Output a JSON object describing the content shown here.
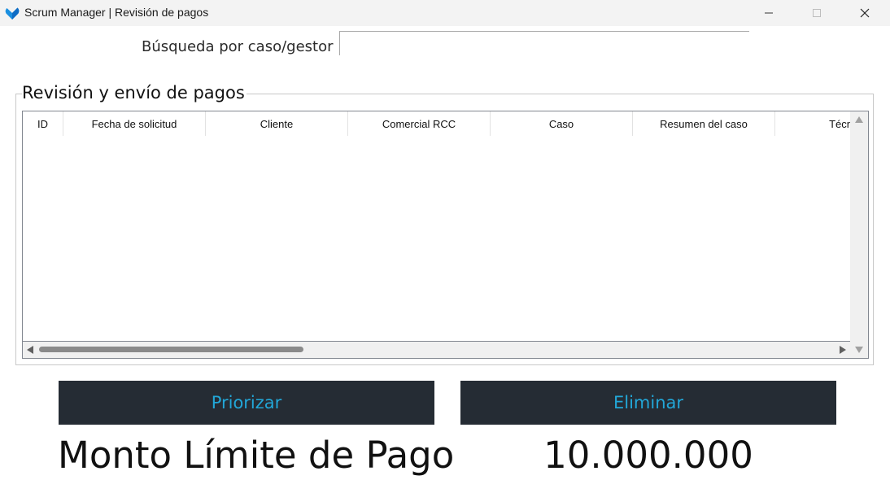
{
  "window": {
    "title": "Scrum Manager | Revisión de pagos",
    "icon": "blue-checkmark-heart-icon",
    "controls": [
      "minimize-icon",
      "maximize-icon",
      "close-icon"
    ]
  },
  "search": {
    "label": "Búsqueda por caso/gestor",
    "value": "",
    "placeholder": ""
  },
  "review_group": {
    "title": "Revisión y envío de pagos",
    "columns": [
      "ID",
      "Fecha de solicitud",
      "Cliente",
      "Comercial RCC",
      "Caso",
      "Resumen del caso",
      "Técn"
    ],
    "rows": []
  },
  "actions": {
    "prioritize_label": "Priorizar",
    "delete_label": "Eliminar"
  },
  "limit": {
    "label": "Monto Límite de Pago",
    "value": "10.000.000"
  },
  "colors": {
    "button_bg": "#252c34",
    "button_text": "#22a7d8",
    "title_bar": "#f3f3f3"
  }
}
